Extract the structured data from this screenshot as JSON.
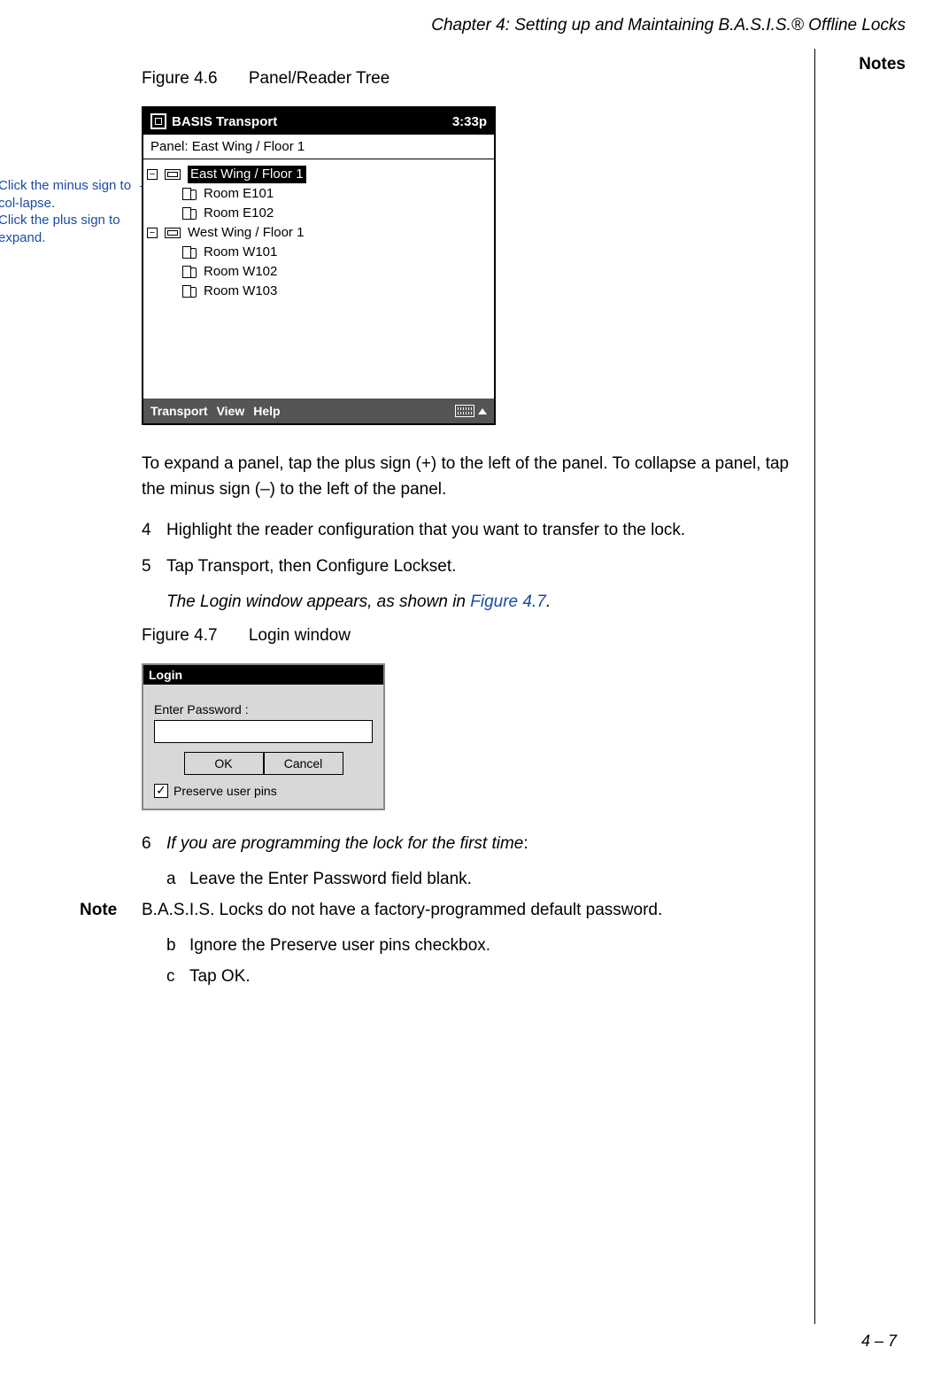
{
  "header": {
    "chapter": "Chapter 4: Setting up and Maintaining B.A.S.I.S.® Offline Locks",
    "notes": "Notes"
  },
  "figure46": {
    "label": "Figure 4.6",
    "title": "Panel/Reader Tree"
  },
  "callout": {
    "text": "Click the minus sign to col-lapse.\nClick the plus sign to expand."
  },
  "shot1": {
    "app": "BASIS Transport",
    "time": "3:33p",
    "panelLabel": "Panel: East Wing / Floor 1",
    "nodes": {
      "p1": "East Wing / Floor 1",
      "p1c1": "Room E101",
      "p1c2": "Room E102",
      "p2": "West Wing / Floor 1",
      "p2c1": "Room W101",
      "p2c2": "Room W102",
      "p2c3": "Room W103"
    },
    "menu": {
      "transport": "Transport",
      "view": "View",
      "help": "Help"
    },
    "expander_minus": "−",
    "expander_minus2": "−"
  },
  "para1": "To expand a panel, tap the plus sign (+) to the left of the panel. To collapse a panel, tap the minus sign (–) to the left of the panel.",
  "step4": {
    "n": "4",
    "t": "Highlight the reader configuration that you want to transfer to the lock."
  },
  "step5": {
    "n": "5",
    "t": "Tap Transport, then Configure Lockset.",
    "result_pre": "The Login window appears, as shown in ",
    "result_link": "Figure 4.7",
    "result_post": "."
  },
  "figure47": {
    "label": "Figure 4.7",
    "title": "Login window"
  },
  "shot2": {
    "title": "Login",
    "label": "Enter Password :",
    "value": "",
    "ok": "OK",
    "cancel": "Cancel",
    "check_mark": "✓",
    "checkLabel": "Preserve user pins"
  },
  "step6": {
    "n": "6",
    "t_pre": "If you are programming the lock for the first time",
    "t_post": ":",
    "a_letter": "a",
    "a": "Leave the Enter Password field blank."
  },
  "noteRow": {
    "label": "Note",
    "text": "B.A.S.I.S. Locks do not have a factory-programmed default password."
  },
  "sub_b": {
    "letter": "b",
    "text": "Ignore the Preserve user pins checkbox."
  },
  "sub_c": {
    "letter": "c",
    "text": "Tap OK."
  },
  "pageNum": "4 – 7"
}
